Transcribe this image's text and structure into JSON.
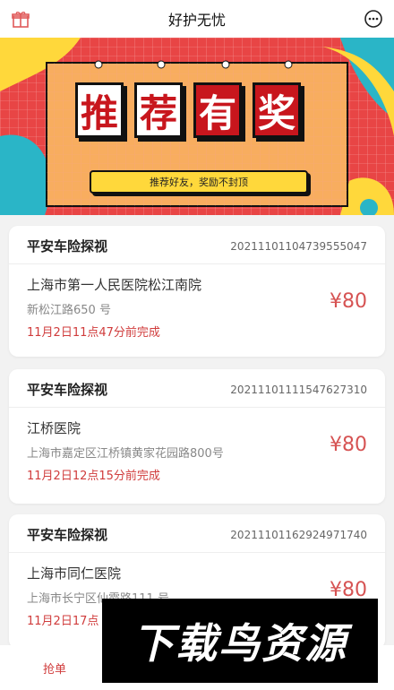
{
  "header": {
    "title": "好护无忧",
    "left_icon": "gift-icon",
    "right_icon": "message-icon"
  },
  "banner": {
    "chars": [
      "推",
      "荐",
      "有",
      "奖"
    ],
    "slogan": "推荐好友，奖励不封顶"
  },
  "orders": [
    {
      "title": "平安车险探视",
      "order_no": "20211101104739555047",
      "hospital": "上海市第一人民医院松江南院",
      "address": "新松江路650 号",
      "deadline": "11月2日11点47分前完成",
      "price": "¥80"
    },
    {
      "title": "平安车险探视",
      "order_no": "20211101111547627310",
      "hospital": "江桥医院",
      "address": "上海市嘉定区江桥镇黄家花园路800号",
      "deadline": "11月2日12点15分前完成",
      "price": "¥80"
    },
    {
      "title": "平安车险探视",
      "order_no": "20211101162924971740",
      "hospital": "上海市同仁医院",
      "address": "上海市长宁区仙霞路111 号",
      "deadline": "11月2日17点",
      "price": "¥80"
    }
  ],
  "tabbar": {
    "grab_label": "抢单"
  },
  "watermark": {
    "text": "下载鸟资源"
  },
  "colors": {
    "accent": "#d03c3c",
    "banner_red": "#e63a3a",
    "banner_yellow": "#ffd83b"
  }
}
